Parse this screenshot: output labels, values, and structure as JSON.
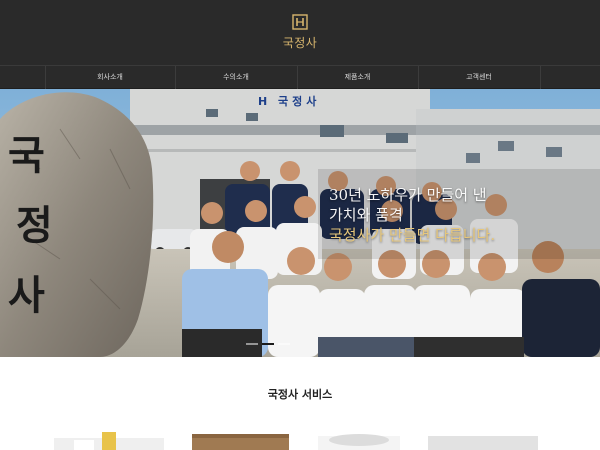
{
  "header": {
    "logo_text": "국정사"
  },
  "nav": {
    "items": [
      {
        "label": "회사소개"
      },
      {
        "label": "수의소개"
      },
      {
        "label": "제품소개"
      },
      {
        "label": "고객센터"
      }
    ]
  },
  "hero": {
    "building_sign": "국정사",
    "stone_text": [
      "국",
      "정",
      "사"
    ],
    "caption": {
      "line1": "30년 노하우가 만들어 낸",
      "line2": "가치와 품격",
      "line3": "국정사가 만들면 다릅니다."
    },
    "active_slide": 2,
    "slide_count": 3
  },
  "services": {
    "title": "국정사 서비스"
  },
  "colors": {
    "header_bg": "#2a2a2a",
    "accent_gold": "#d7b56d"
  }
}
